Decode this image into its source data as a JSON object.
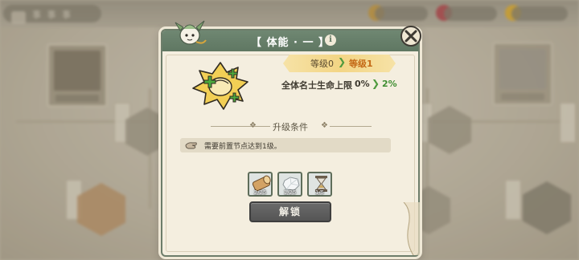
{
  "background": {
    "title": "事 事 事"
  },
  "dialog": {
    "title": "【 体能 · 一 】",
    "level": {
      "from": "等级0",
      "to": "等级1"
    },
    "stat": {
      "label": "全体名士生命上限",
      "from": "0%",
      "to": "2%"
    },
    "section_title": "升级条件",
    "condition_text": "需要前置节点达到1级。",
    "costs": [
      {
        "name": "wood",
        "count": "2/25"
      },
      {
        "name": "stone",
        "count": "1/25"
      },
      {
        "name": "hourglass",
        "count": "1/5"
      }
    ],
    "unlock_label": "解锁"
  },
  "colors": {
    "header": "#6f8772",
    "upgrade_arrow": "#4f9a3e",
    "target_level": "#c46a17",
    "button": "#5e5e5e"
  },
  "icons": [
    "mascot-icon",
    "info-icon",
    "close-icon",
    "fist-buff-icon",
    "hand-icon",
    "wood-icon",
    "stone-icon",
    "hourglass-icon"
  ]
}
